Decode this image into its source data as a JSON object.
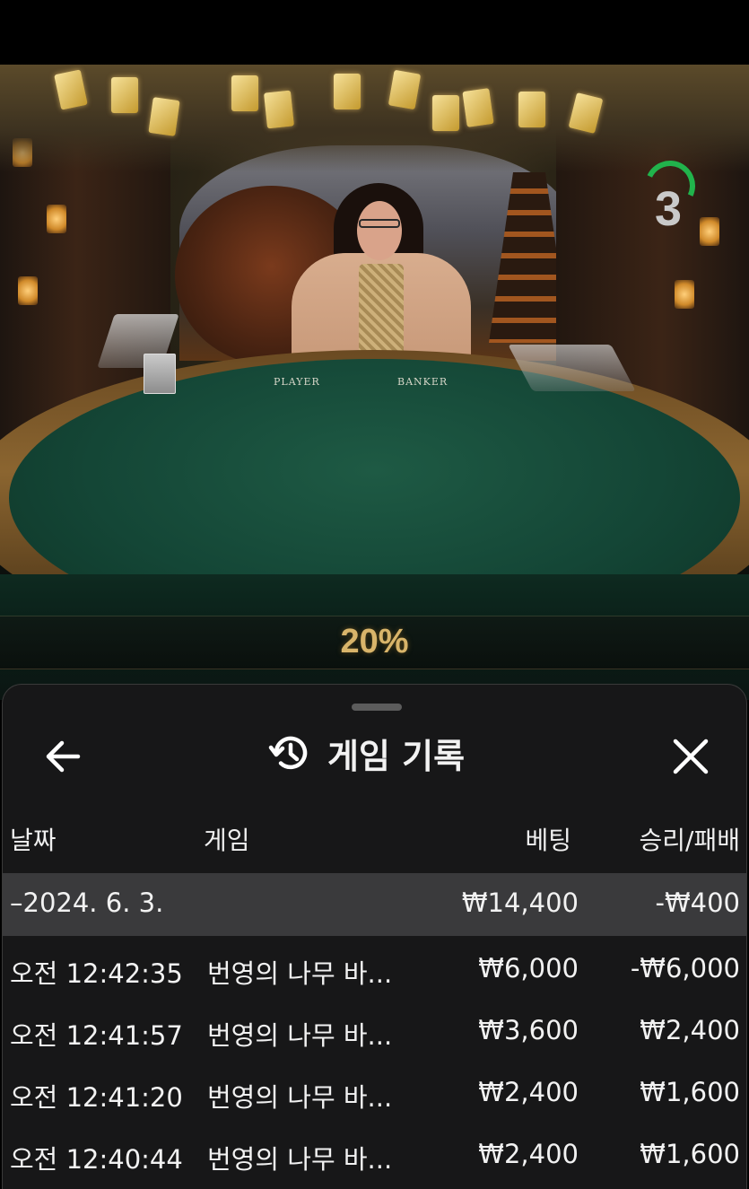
{
  "video": {
    "timer_count": "3",
    "felt_labels": {
      "player": "PLAYER",
      "banker": "BANKER"
    }
  },
  "progress": {
    "text": "20%",
    "value": 20
  },
  "history_sheet": {
    "title": "게임 기록",
    "icons": {
      "back": "arrow-left-icon",
      "title": "history-icon",
      "close": "close-icon"
    },
    "columns": {
      "date": "날짜",
      "game": "게임",
      "bet": "베팅",
      "result": "승리/패배"
    },
    "date_group": {
      "date": "–2024. 6. 3.",
      "bet": "₩14,400",
      "result": "-₩400"
    },
    "rows": [
      {
        "time": "오전 12:42:35",
        "game": "번영의 나무 바...",
        "bet": "₩6,000",
        "result": "-₩6,000"
      },
      {
        "time": "오전 12:41:57",
        "game": "번영의 나무 바...",
        "bet": "₩3,600",
        "result": "₩2,400"
      },
      {
        "time": "오전 12:41:20",
        "game": "번영의 나무 바...",
        "bet": "₩2,400",
        "result": "₩1,600"
      },
      {
        "time": "오전 12:40:44",
        "game": "번영의 나무 바...",
        "bet": "₩2,400",
        "result": "₩1,600"
      }
    ]
  },
  "colors": {
    "accent_gold": "#d8b46a",
    "timer_green": "#21b34c",
    "sheet_bg": "#181819",
    "date_row_bg": "#3a3a3c"
  }
}
